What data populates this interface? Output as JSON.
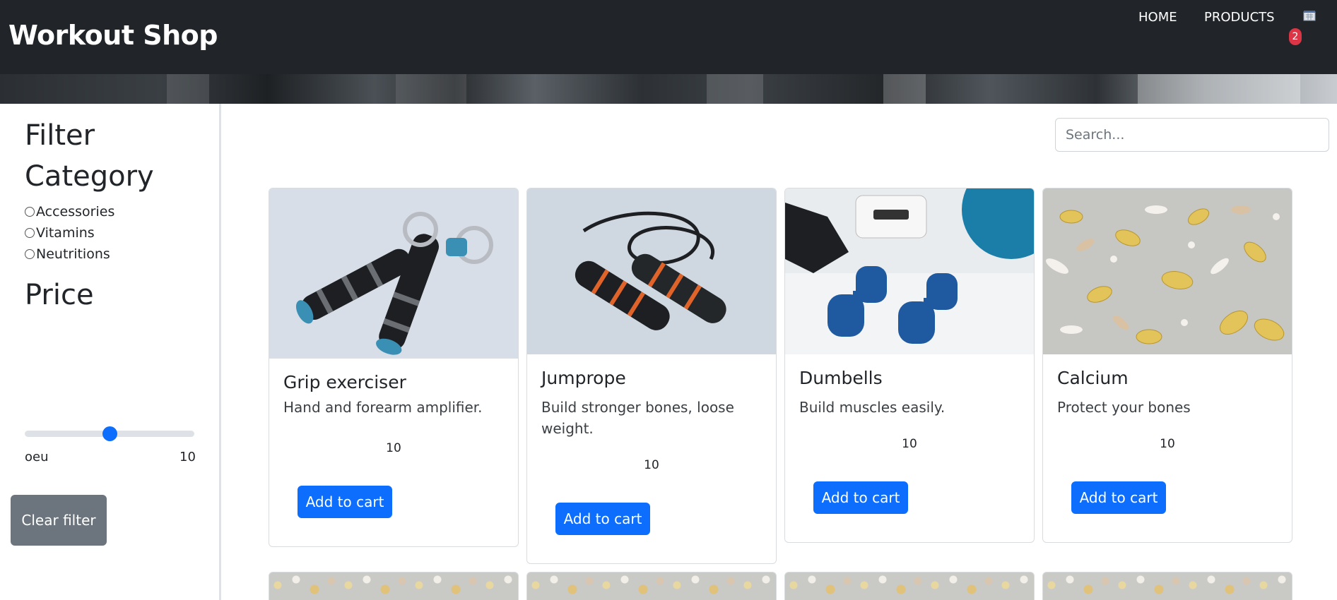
{
  "navbar": {
    "brand": "Workout Shop",
    "links": [
      "HOME",
      "PRODUCTS"
    ],
    "cart_count": "2",
    "cart_icon": "cart-icon"
  },
  "sidebar": {
    "filter_title": "Filter",
    "category_title": "Category",
    "categories": [
      "Accessories",
      "Vitamins",
      "Neutritions"
    ],
    "price_title": "Price",
    "price_slider_fraction": 0.5,
    "range_min_label": "oeu",
    "range_max_label": "10",
    "clear_label": "Clear filter"
  },
  "search": {
    "placeholder": "Search..."
  },
  "products": [
    {
      "name": "Grip exerciser",
      "description": "Hand and forearm amplifier.",
      "price": "10",
      "button": "Add to cart",
      "image": "grip-exerciser-image"
    },
    {
      "name": "Jumprope",
      "description": "Build stronger bones, loose weight.",
      "price": "10",
      "button": "Add to cart",
      "image": "jumprope-image"
    },
    {
      "name": "Dumbells",
      "description": "Build muscles easily.",
      "price": "10",
      "button": "Add to cart",
      "image": "dumbells-image"
    },
    {
      "name": "Calcium",
      "description": "Protect your bones",
      "price": "10",
      "button": "Add to cart",
      "image": "calcium-image"
    }
  ],
  "colors": {
    "navbar": "#212529",
    "primary": "#0d6efd",
    "secondary": "#6c757d",
    "badge": "#dc3545"
  }
}
